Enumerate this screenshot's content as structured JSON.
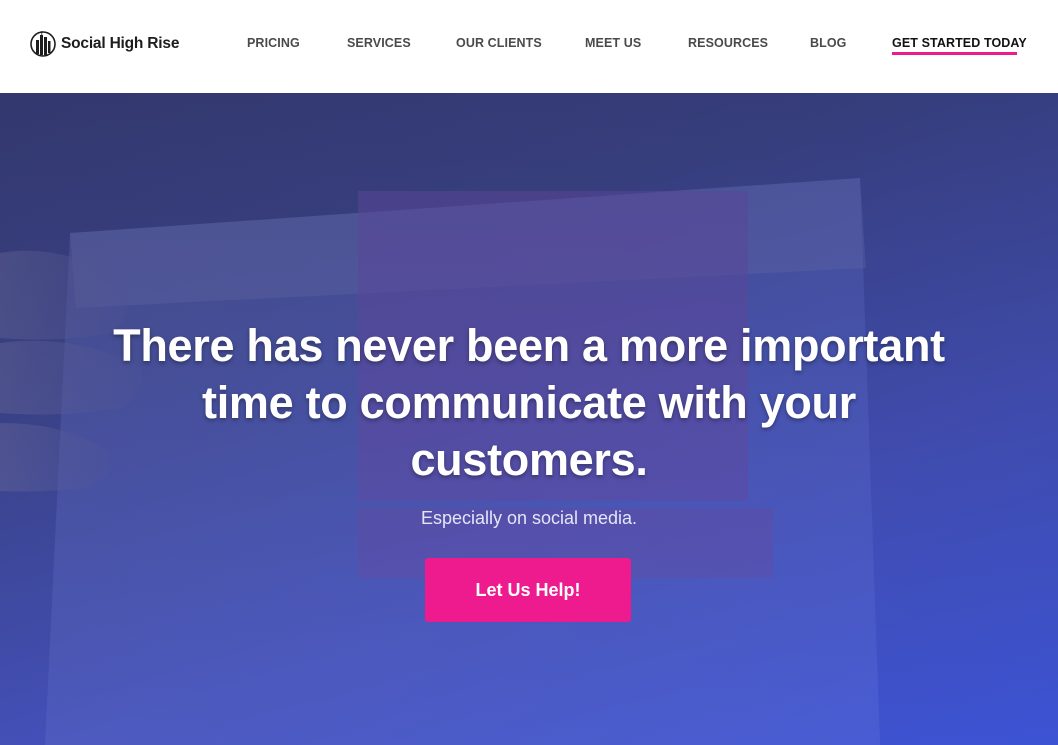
{
  "brand": {
    "name": "Social High Rise",
    "accent_color": "#ee1b8e",
    "logo_icon": "building-skyline-icon"
  },
  "nav": {
    "items": [
      {
        "label": "PRICING"
      },
      {
        "label": "SERVICES"
      },
      {
        "label": "OUR CLIENTS"
      },
      {
        "label": "MEET US"
      },
      {
        "label": "RESOURCES"
      },
      {
        "label": "BLOG"
      },
      {
        "label": "GET STARTED TODAY"
      }
    ]
  },
  "hero": {
    "title": "There has never been a more important time to communicate with your customers.",
    "subtitle": "Especially on social media.",
    "button_label": "Let Us Help!",
    "background_colors": [
      "#3a3f78",
      "#3c55d8"
    ]
  }
}
